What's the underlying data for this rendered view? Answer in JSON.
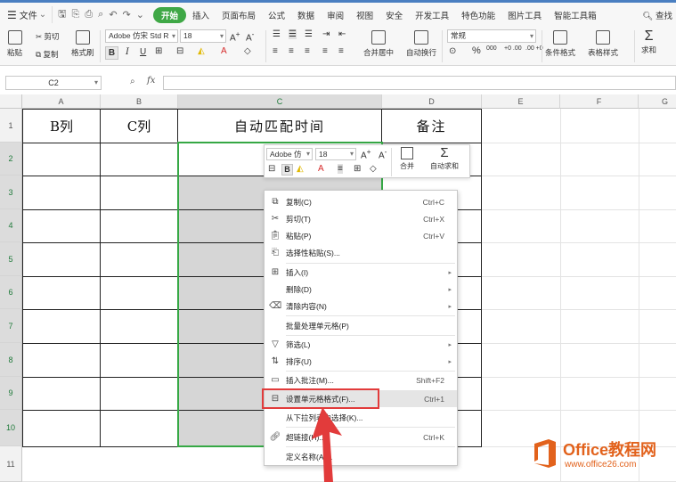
{
  "menubar": {
    "file": "文件",
    "tabs": [
      "开始",
      "插入",
      "页面布局",
      "公式",
      "数据",
      "审阅",
      "视图",
      "安全",
      "开发工具",
      "特色功能",
      "图片工具",
      "智能工具箱"
    ],
    "search": "查找"
  },
  "ribbon": {
    "paste": "粘贴",
    "cut": "剪切",
    "copy": "复制",
    "format_painter": "格式刷",
    "font_name": "Adobe 仿宋 Std R",
    "font_size": "18",
    "bold": "B",
    "italic": "I",
    "underline": "U",
    "merge": "合并居中",
    "wrap": "自动换行",
    "number_format": "常规",
    "percent": "%",
    "thousands": "000",
    "inc_decimal": "+0 .00",
    "dec_decimal": ".00 +0",
    "cond_format": "条件格式",
    "table_style": "表格样式",
    "sum": "求和"
  },
  "formula_bar": {
    "cell_ref": "C2",
    "fx": "fx",
    "value": ""
  },
  "grid": {
    "columns": [
      "A",
      "B",
      "C",
      "D",
      "E",
      "F",
      "G"
    ],
    "rows": [
      "1",
      "2",
      "3",
      "4",
      "5",
      "6",
      "7",
      "8",
      "9",
      "10",
      "11"
    ],
    "header_cells": [
      "B列",
      "C列",
      "自动匹配时间",
      "备注"
    ]
  },
  "mini_toolbar": {
    "font_name": "Adobe 仿",
    "font_size": "18",
    "bold": "B",
    "merge": "合并",
    "autosum": "自动求和"
  },
  "context_menu": {
    "items": [
      {
        "label": "复制(C)",
        "shortcut": "Ctrl+C",
        "icon": "copy-icon"
      },
      {
        "label": "剪切(T)",
        "shortcut": "Ctrl+X",
        "icon": "scissors-icon"
      },
      {
        "label": "粘贴(P)",
        "shortcut": "Ctrl+V",
        "icon": "paste-icon"
      },
      {
        "label": "选择性粘贴(S)...",
        "shortcut": "",
        "icon": "paste-special-icon"
      },
      {
        "label": "插入(I)",
        "shortcut": "",
        "icon": "insert-icon"
      },
      {
        "label": "删除(D)",
        "shortcut": "",
        "icon": ""
      },
      {
        "label": "清除内容(N)",
        "shortcut": "",
        "icon": "eraser-icon"
      },
      {
        "label": "批量处理单元格(P)",
        "shortcut": "",
        "icon": ""
      },
      {
        "label": "筛选(L)",
        "shortcut": "",
        "icon": "filter-icon"
      },
      {
        "label": "排序(U)",
        "shortcut": "",
        "icon": "sort-icon"
      },
      {
        "label": "插入批注(M)...",
        "shortcut": "Shift+F2",
        "icon": "comment-icon"
      },
      {
        "label": "设置单元格格式(F)...",
        "shortcut": "Ctrl+1",
        "icon": "format-cells-icon"
      },
      {
        "label": "从下拉列表中选择(K)...",
        "shortcut": "",
        "icon": ""
      },
      {
        "label": "超链接(H)...",
        "shortcut": "Ctrl+K",
        "icon": "link-icon"
      },
      {
        "label": "定义名称(A)...",
        "shortcut": "",
        "icon": ""
      }
    ]
  },
  "watermark": {
    "brand": "Office教程网",
    "url": "www.office26.com"
  },
  "colors": {
    "accent_green": "#3fa846",
    "selection_border": "#36a845",
    "highlight_red": "#e23b3b",
    "watermark_orange": "#e2621c"
  }
}
